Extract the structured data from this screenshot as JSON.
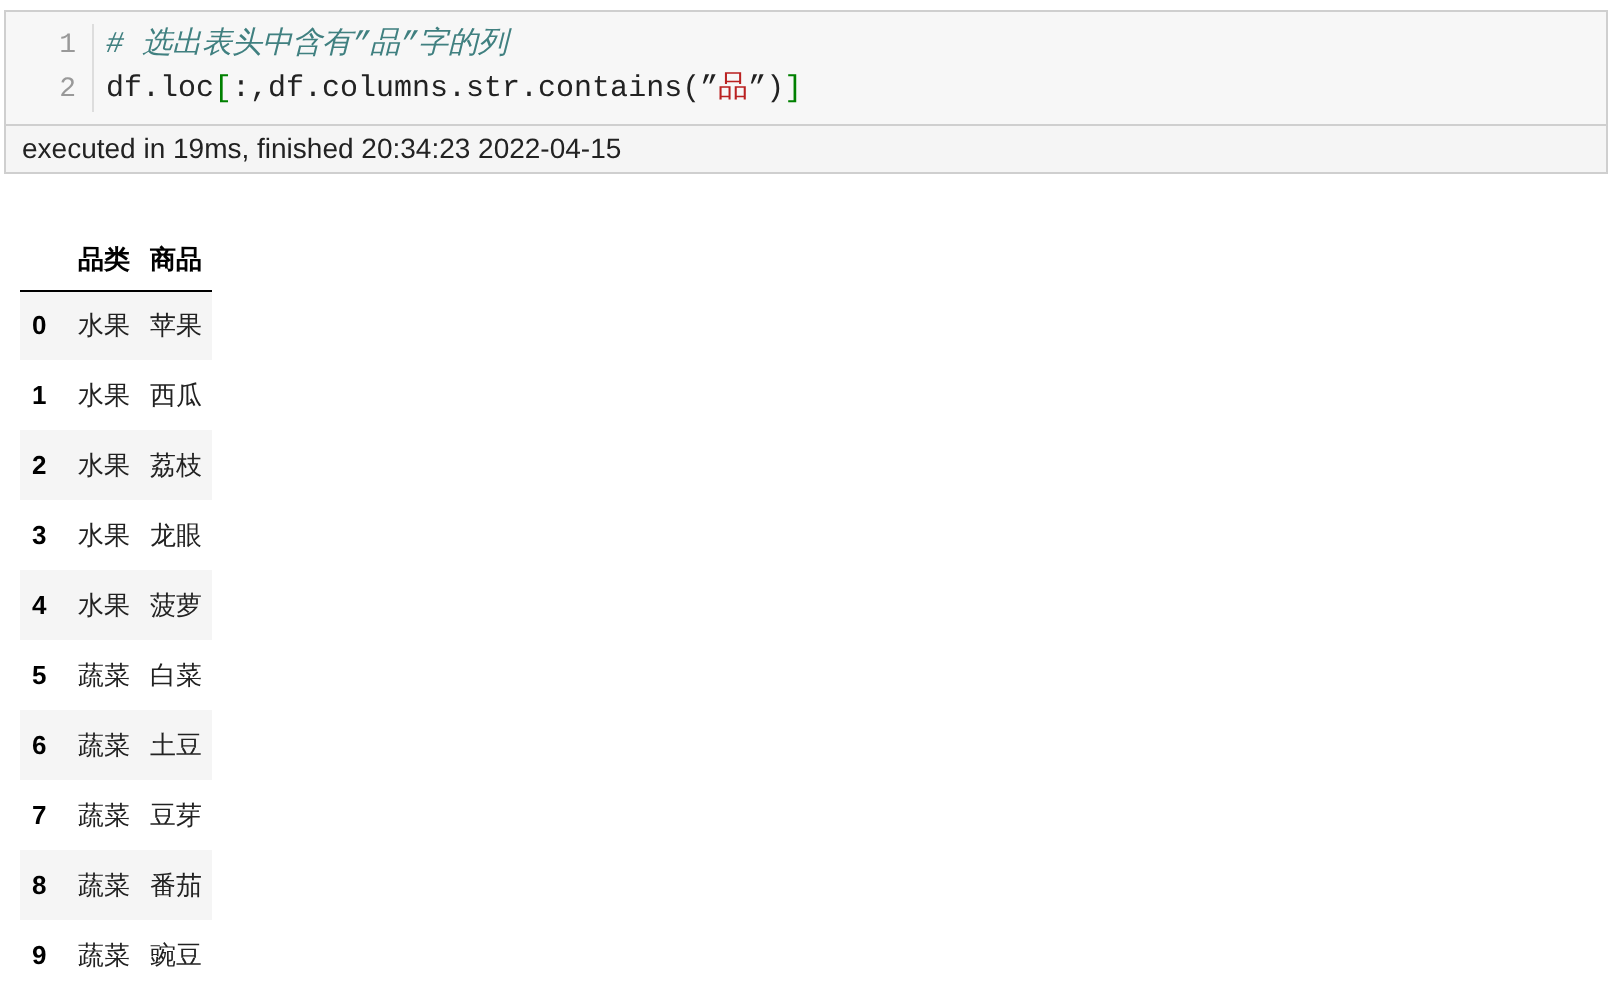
{
  "code_cell": {
    "lines": [
      {
        "number": "1",
        "tokens": [
          {
            "kind": "comment",
            "text": "# 选出表头中含有”品”字的列"
          }
        ]
      },
      {
        "number": "2",
        "tokens": [
          {
            "kind": "plain",
            "text": "df.loc"
          },
          {
            "kind": "bracket",
            "text": "["
          },
          {
            "kind": "plain",
            "text": ":,df.columns.str.contains("
          },
          {
            "kind": "plain",
            "text": "”"
          },
          {
            "kind": "string",
            "text": "品"
          },
          {
            "kind": "plain",
            "text": "”"
          },
          {
            "kind": "plain",
            "text": ")"
          },
          {
            "kind": "bracket",
            "text": "]"
          }
        ]
      }
    ]
  },
  "execution_status": "executed in 19ms, finished 20:34:23 2022-04-15",
  "table": {
    "columns": [
      "品类",
      "商品"
    ],
    "rows": [
      {
        "index": "0",
        "cells": [
          "水果",
          "苹果"
        ]
      },
      {
        "index": "1",
        "cells": [
          "水果",
          "西瓜"
        ]
      },
      {
        "index": "2",
        "cells": [
          "水果",
          "荔枝"
        ]
      },
      {
        "index": "3",
        "cells": [
          "水果",
          "龙眼"
        ]
      },
      {
        "index": "4",
        "cells": [
          "水果",
          "菠萝"
        ]
      },
      {
        "index": "5",
        "cells": [
          "蔬菜",
          "白菜"
        ]
      },
      {
        "index": "6",
        "cells": [
          "蔬菜",
          "土豆"
        ]
      },
      {
        "index": "7",
        "cells": [
          "蔬菜",
          "豆芽"
        ]
      },
      {
        "index": "8",
        "cells": [
          "蔬菜",
          "番茄"
        ]
      },
      {
        "index": "9",
        "cells": [
          "蔬菜",
          "豌豆"
        ]
      }
    ]
  }
}
